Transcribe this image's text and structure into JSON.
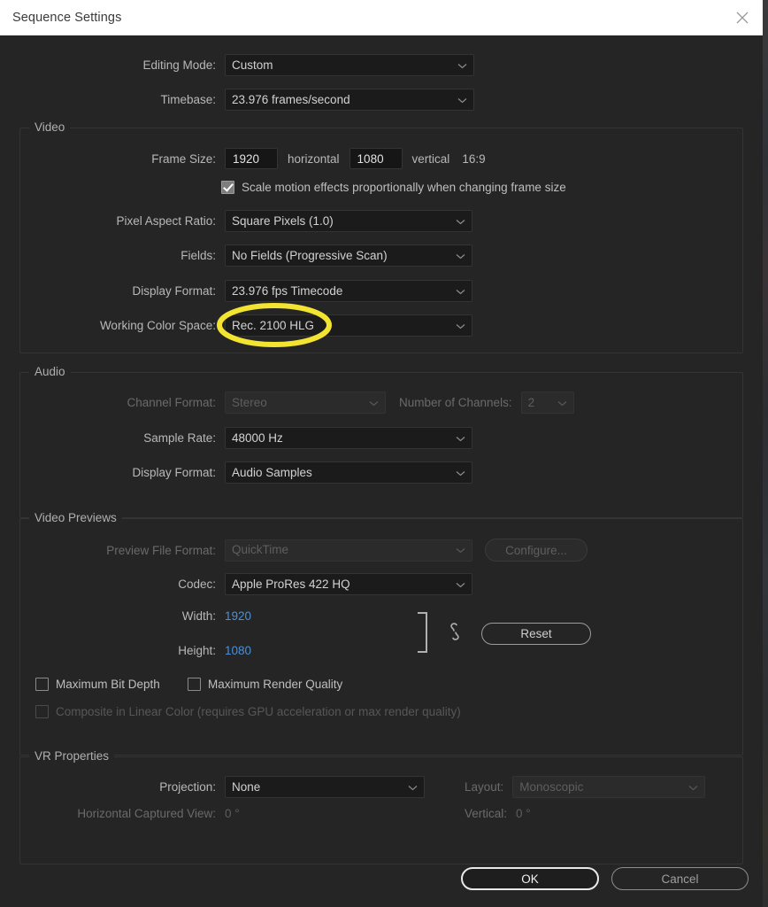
{
  "window": {
    "title": "Sequence Settings",
    "close_icon": "close-icon"
  },
  "top_fields": [
    {
      "label": "Editing Mode:",
      "value": "Custom"
    },
    {
      "label": "Timebase:",
      "value": "23.976  frames/second"
    }
  ],
  "video": {
    "legend": "Video",
    "frame_size": {
      "label": "Frame Size:",
      "horizontal_value": "1920",
      "horizontal_label": "horizontal",
      "vertical_value": "1080",
      "vertical_label": "vertical",
      "aspect": "16:9"
    },
    "scale_motion": {
      "label": "Scale motion effects proportionally when changing frame size",
      "checked": true
    },
    "pixel_aspect_ratio": {
      "label": "Pixel Aspect Ratio:",
      "value": "Square Pixels (1.0)"
    },
    "fields": {
      "label": "Fields:",
      "value": "No Fields (Progressive Scan)"
    },
    "display_format": {
      "label": "Display Format:",
      "value": "23.976 fps Timecode"
    },
    "working_color_space": {
      "label": "Working Color Space:",
      "value": "Rec. 2100 HLG"
    }
  },
  "audio": {
    "legend": "Audio",
    "channel_format": {
      "label": "Channel Format:",
      "value": "Stereo",
      "disabled": true
    },
    "number_of_channels": {
      "label": "Number of Channels:",
      "value": "2",
      "disabled": true
    },
    "sample_rate": {
      "label": "Sample Rate:",
      "value": "48000 Hz"
    },
    "display_format": {
      "label": "Display Format:",
      "value": "Audio Samples"
    }
  },
  "video_previews": {
    "legend": "Video Previews",
    "preview_file_format": {
      "label": "Preview File Format:",
      "value": "QuickTime",
      "disabled": true
    },
    "configure_button": "Configure...",
    "codec": {
      "label": "Codec:",
      "value": "Apple ProRes 422 HQ"
    },
    "width": {
      "label": "Width:",
      "value": "1920"
    },
    "height": {
      "label": "Height:",
      "value": "1080"
    },
    "reset_button": "Reset",
    "link_icon": "chain-link-icon",
    "max_bit_depth": {
      "label": "Maximum Bit Depth",
      "checked": false
    },
    "max_render_quality": {
      "label": "Maximum Render Quality",
      "checked": false
    },
    "composite_linear": {
      "label": "Composite in Linear Color (requires GPU acceleration or max render quality)",
      "checked": false,
      "disabled": true
    }
  },
  "vr_properties": {
    "legend": "VR Properties",
    "projection": {
      "label": "Projection:",
      "value": "None"
    },
    "layout": {
      "label": "Layout:",
      "value": "Monoscopic",
      "disabled": true
    },
    "horizontal_captured_view": {
      "label": "Horizontal Captured View:",
      "value": "0 °",
      "disabled": true
    },
    "vertical": {
      "label": "Vertical:",
      "value": "0 °",
      "disabled": true
    }
  },
  "footer": {
    "ok_label": "OK",
    "cancel_label": "Cancel"
  },
  "annotation": {
    "type": "ellipse-highlight",
    "target": "Working Color Space value",
    "color": "#f2e430"
  },
  "colors": {
    "dialog_bg": "#252525",
    "titlebar_bg": "#ffffff",
    "field_bg": "#1b1b1b",
    "accent_blue": "#4a90d9",
    "highlight_yellow": "#f2e430"
  }
}
